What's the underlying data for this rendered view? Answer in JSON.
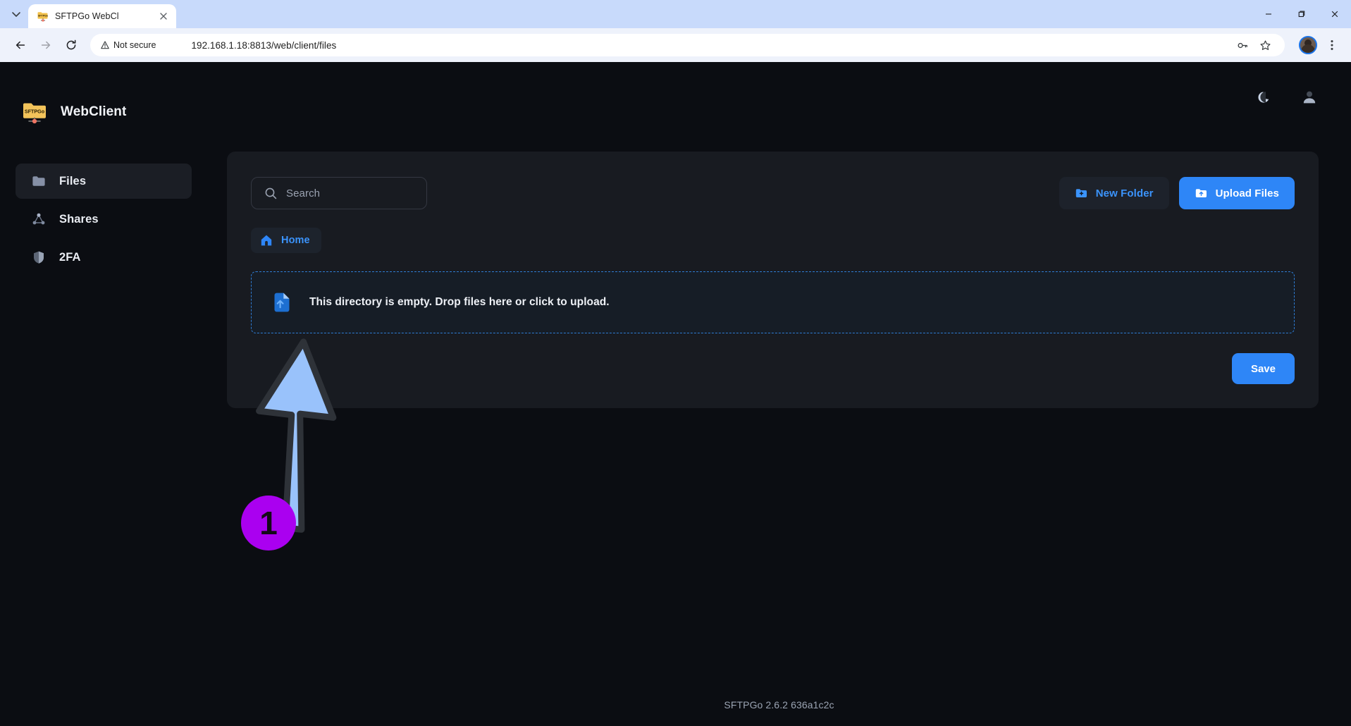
{
  "browser": {
    "tab": {
      "title": "SFTPGo WebCl",
      "favicon_icon": "sftpgo-folder-icon",
      "close_icon": "close-icon",
      "tab_search_icon": "chevron-down-icon"
    },
    "window_controls": {
      "minimize": "minimize-icon",
      "maximize": "maximize-icon",
      "close": "close-icon"
    },
    "toolbar": {
      "back_icon": "back-arrow-icon",
      "forward_icon": "forward-arrow-icon",
      "reload_icon": "reload-icon",
      "security_label": "Not secure",
      "security_icon": "warning-triangle-icon",
      "url": "192.168.1.18:8813/web/client/files",
      "password_icon": "key-icon",
      "bookmark_icon": "star-icon",
      "profile_icon": "profile-avatar-icon",
      "menu_icon": "three-dot-menu-icon"
    }
  },
  "sidebar": {
    "brand": {
      "logo_icon": "sftpgo-logo-icon",
      "logo_text": "SFTPGo",
      "title": "WebClient"
    },
    "items": [
      {
        "label": "Files",
        "icon": "folder-icon",
        "active": true
      },
      {
        "label": "Shares",
        "icon": "share-nodes-icon",
        "active": false
      },
      {
        "label": "2FA",
        "icon": "shield-icon",
        "active": false
      }
    ]
  },
  "topbar": {
    "theme_toggle_icon": "moon-icon",
    "profile_icon": "user-icon"
  },
  "main": {
    "search": {
      "placeholder": "Search",
      "value": "",
      "icon": "search-icon"
    },
    "actions": {
      "new_folder_label": "New Folder",
      "new_folder_icon": "folder-plus-icon",
      "upload_files_label": "Upload Files",
      "upload_files_icon": "folder-upload-icon"
    },
    "breadcrumb": {
      "label": "Home",
      "icon": "home-icon"
    },
    "dropzone": {
      "text": "This directory is empty. Drop files here or click to upload.",
      "icon": "file-upload-icon"
    },
    "save_label": "Save"
  },
  "footer": {
    "text": "SFTPGo 2.6.2 636a1c2c"
  },
  "annotation": {
    "step_number": "1",
    "arrow_icon": "pointer-arrow-icon"
  },
  "colors": {
    "accent_blue": "#2e86f7",
    "link_blue": "#3b94fd",
    "page_bg": "#0b0d12",
    "card_bg": "#181b21",
    "badge_purple": "#aa00f0",
    "arrow_blue": "#99c2fb"
  }
}
